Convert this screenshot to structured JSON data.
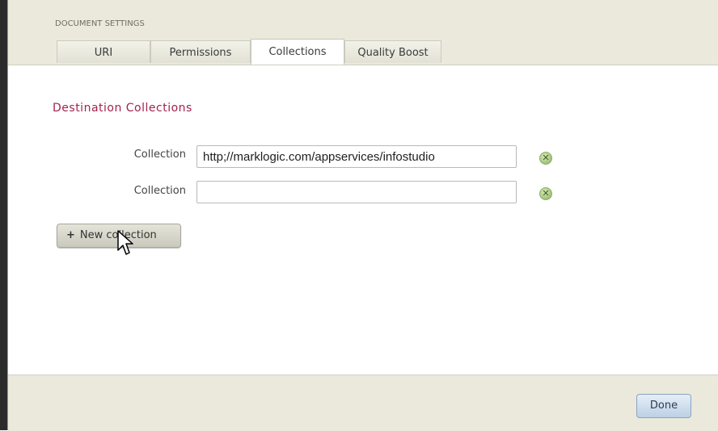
{
  "header": {
    "title": "DOCUMENT SETTINGS",
    "tabs": [
      {
        "label": "URI"
      },
      {
        "label": "Permissions"
      },
      {
        "label": "Collections",
        "active": true
      },
      {
        "label": "Quality Boost"
      }
    ]
  },
  "content": {
    "section_title": "Destination Collections",
    "collections": [
      {
        "label": "Collection",
        "value": "http;//marklogic.com/appservices/infostudio"
      },
      {
        "label": "Collection",
        "value": ""
      }
    ],
    "new_collection_label": "New collection",
    "remove_icon": "remove-x-icon"
  },
  "footer": {
    "done_label": "Done"
  },
  "colors": {
    "section_title": "#a3224e",
    "panel_bg": "#eae9dc",
    "done_button": "#bcd0e6"
  }
}
